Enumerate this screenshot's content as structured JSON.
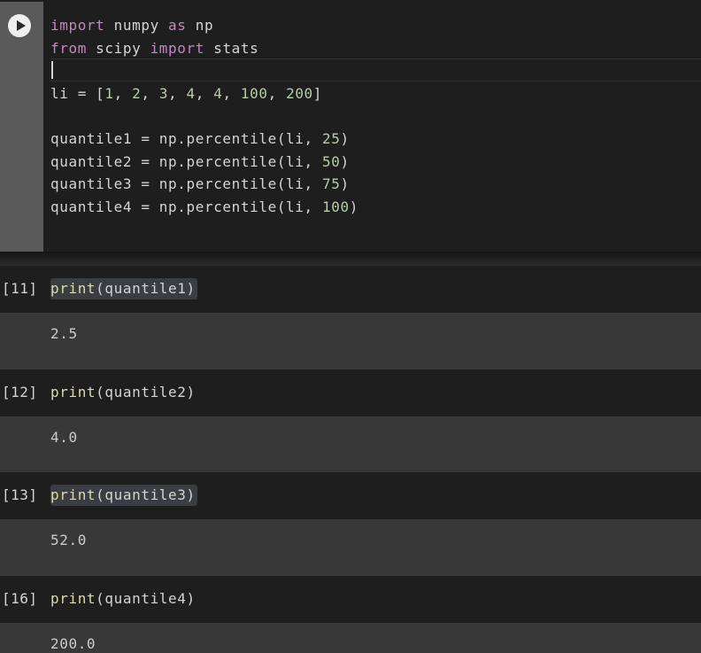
{
  "active_cell": {
    "run_button_icon": "play-icon",
    "lines": [
      [
        {
          "t": "import",
          "c": "kw"
        },
        {
          "t": " numpy ",
          "c": "plain"
        },
        {
          "t": "as",
          "c": "kw"
        },
        {
          "t": " np",
          "c": "plain"
        }
      ],
      [
        {
          "t": "from",
          "c": "kw"
        },
        {
          "t": " scipy ",
          "c": "plain"
        },
        {
          "t": "import",
          "c": "kw"
        },
        {
          "t": " stats",
          "c": "plain"
        }
      ],
      [],
      [
        {
          "t": "li = [",
          "c": "plain"
        },
        {
          "t": "1",
          "c": "num"
        },
        {
          "t": ", ",
          "c": "plain"
        },
        {
          "t": "2",
          "c": "num"
        },
        {
          "t": ", ",
          "c": "plain"
        },
        {
          "t": "3",
          "c": "num"
        },
        {
          "t": ", ",
          "c": "plain"
        },
        {
          "t": "4",
          "c": "num"
        },
        {
          "t": ", ",
          "c": "plain"
        },
        {
          "t": "4",
          "c": "num"
        },
        {
          "t": ", ",
          "c": "plain"
        },
        {
          "t": "100",
          "c": "num"
        },
        {
          "t": ", ",
          "c": "plain"
        },
        {
          "t": "200",
          "c": "num"
        },
        {
          "t": "]",
          "c": "plain"
        }
      ],
      [],
      [
        {
          "t": "quantile1 = np.percentile(li, ",
          "c": "plain"
        },
        {
          "t": "25",
          "c": "num"
        },
        {
          "t": ")",
          "c": "plain"
        }
      ],
      [
        {
          "t": "quantile2 = np.percentile(li, ",
          "c": "plain"
        },
        {
          "t": "50",
          "c": "num"
        },
        {
          "t": ")",
          "c": "plain"
        }
      ],
      [
        {
          "t": "quantile3 = np.percentile(li, ",
          "c": "plain"
        },
        {
          "t": "75",
          "c": "num"
        },
        {
          "t": ")",
          "c": "plain"
        }
      ],
      [
        {
          "t": "quantile4 = np.percentile(li, ",
          "c": "plain"
        },
        {
          "t": "100",
          "c": "num"
        },
        {
          "t": ")",
          "c": "plain"
        }
      ]
    ]
  },
  "cells": [
    {
      "count": "[11]",
      "fn": "print",
      "args": "(quantile1)",
      "output": "2.5",
      "selected": true
    },
    {
      "count": "[12]",
      "fn": "print",
      "args": "(quantile2)",
      "output": "4.0",
      "selected": false
    },
    {
      "count": "[13]",
      "fn": "print",
      "args": "(quantile3)",
      "output": "52.0",
      "selected": true
    },
    {
      "count": "[16]",
      "fn": "print",
      "args": "(quantile4)",
      "output": "200.0",
      "selected": false
    }
  ]
}
